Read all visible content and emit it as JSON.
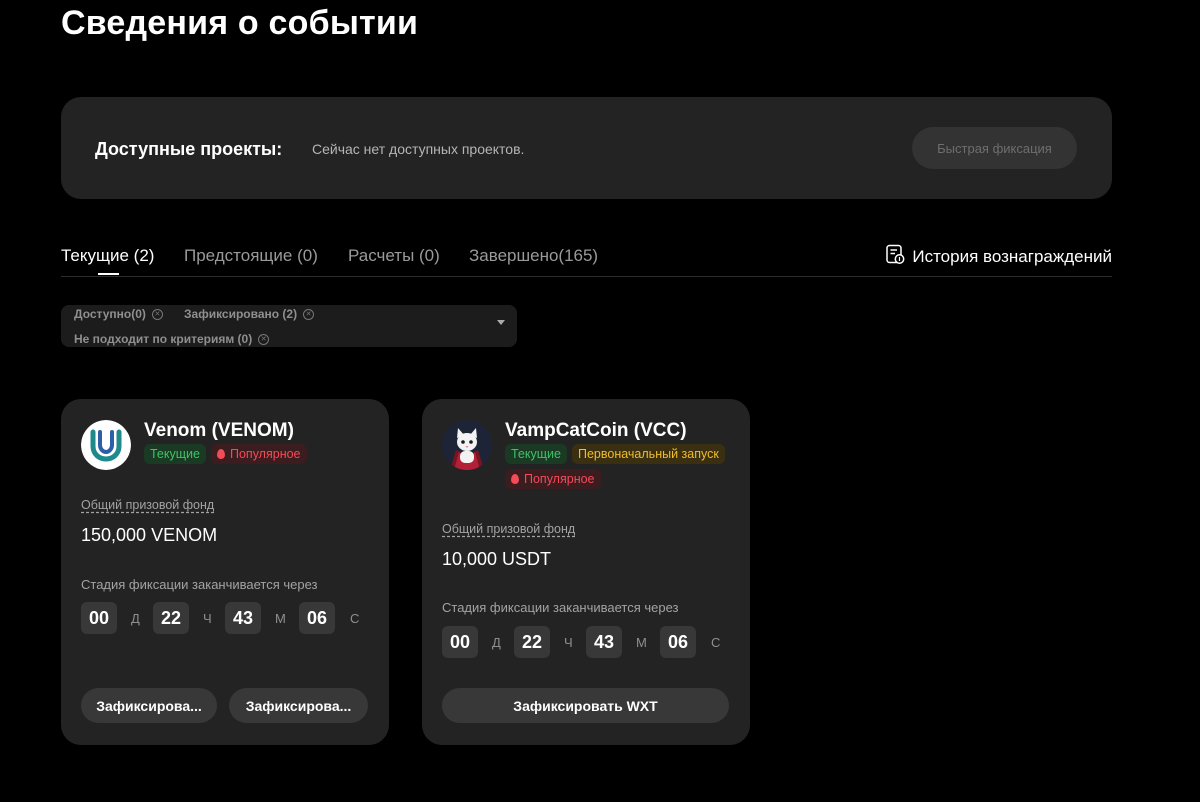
{
  "page": {
    "title": "Сведения о событии"
  },
  "projects": {
    "label": "Доступные проекты:",
    "empty_text": "Сейчас нет доступных проектов.",
    "quick_button": "Быстрая фиксация"
  },
  "tabs": [
    {
      "label": "Текущие (2)",
      "active": true
    },
    {
      "label": "Предстоящие (0)"
    },
    {
      "label": "Расчеты (0)"
    },
    {
      "label": "Завершено(165)"
    }
  ],
  "history": {
    "label": "История вознаграждений",
    "icon": "reward-history-icon"
  },
  "filters": [
    {
      "label": "Доступно(0)"
    },
    {
      "label": "Зафиксировано (2)"
    },
    {
      "label": "Не подходит по критериям (0)"
    }
  ],
  "cards": [
    {
      "title": "Venom (VENOM)",
      "logo": "venom-logo",
      "badges": [
        "Текущие",
        "Популярное"
      ],
      "prize_label": "Общий призовой фонд",
      "prize_value": "150,000 VENOM",
      "stage_label": "Стадия фиксации заканчивается через",
      "countdown": {
        "d": "00",
        "h": "22",
        "m": "43",
        "s": "06"
      },
      "units": {
        "d": "Д",
        "h": "Ч",
        "m": "М",
        "s": "С"
      },
      "buttons": [
        "Зафиксирова...",
        "Зафиксирова..."
      ]
    },
    {
      "title": "VampCatCoin (VCC)",
      "logo": "vampcat-logo",
      "badges": [
        "Текущие",
        "Первоначальный запуск",
        "Популярное"
      ],
      "prize_label": "Общий призовой фонд",
      "prize_value": "10,000 USDT",
      "stage_label": "Стадия фиксации заканчивается через",
      "countdown": {
        "d": "00",
        "h": "22",
        "m": "43",
        "s": "06"
      },
      "units": {
        "d": "Д",
        "h": "Ч",
        "m": "М",
        "s": "С"
      },
      "buttons": [
        "Зафиксировать WXT"
      ]
    }
  ],
  "colors": {
    "background": "#000000",
    "panel": "#232323",
    "current_badge": "#3fc267",
    "popular_badge": "#f34b58",
    "launch_badge": "#f0bd2f"
  }
}
